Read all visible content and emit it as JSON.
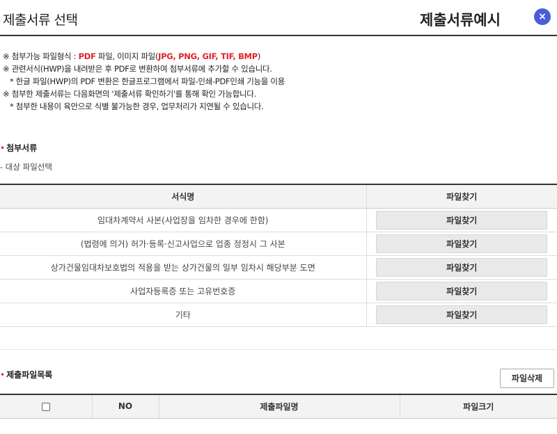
{
  "header": {
    "title": "제출서류 선택",
    "example_title": "제출서류예시",
    "close_label": "×"
  },
  "notes": {
    "line1_prefix": "※ 첨부가능 파일형식 : ",
    "line1_pdf": "PDF",
    "line1_mid": " 파일, 이미지 파일(",
    "line1_formats": "JPG, PNG, GIF, TIF, BMP",
    "line1_suffix": ")",
    "line2": "※ 관련서식(HWP)을 내려받은 후 PDF로 변환하여 첨부서류에 추가할 수 있습니다.",
    "line3": "* 한글 파일(HWP)의 PDF 변환은 한글프로그램에서 파일-인쇄-PDF인쇄 기능을 이용",
    "line4": "※ 첨부한 제출서류는 다음화면의 '제출서류 확인하기'를 통해 확인 가능합니다.",
    "line5": "* 첨부한 내용이 육안으로 식별 불가능한 경우, 업무처리가 지연될 수 있습니다."
  },
  "attach": {
    "title": "첨부서류",
    "sub_label": "- 대상 파일선택",
    "col_form": "서식명",
    "col_find": "파일찾기",
    "rows": [
      {
        "name": "임대차계약서 사본(사업장을 임차한 경우에 한함)",
        "btn": "파일찾기"
      },
      {
        "name": "(법령에 의거) 허가·등록·신고사업으로 업종 정정시 그 사본",
        "btn": "파일찾기"
      },
      {
        "name": "상가건물임대차보호법의 적용을 받는 상가건물의 일부 임차시 해당부분 도면",
        "btn": "파일찾기"
      },
      {
        "name": "사업자등록증 또는 고유번호증",
        "btn": "파일찾기"
      },
      {
        "name": "기타",
        "btn": "파일찾기"
      }
    ]
  },
  "submit_list": {
    "title": "제출파일목록",
    "delete_label": "파일삭제",
    "col_no": "NO",
    "col_filename": "제출파일명",
    "col_size": "파일크기"
  },
  "colors": {
    "accent_red": "#e0242b",
    "close_blue": "#4a5fd6"
  }
}
